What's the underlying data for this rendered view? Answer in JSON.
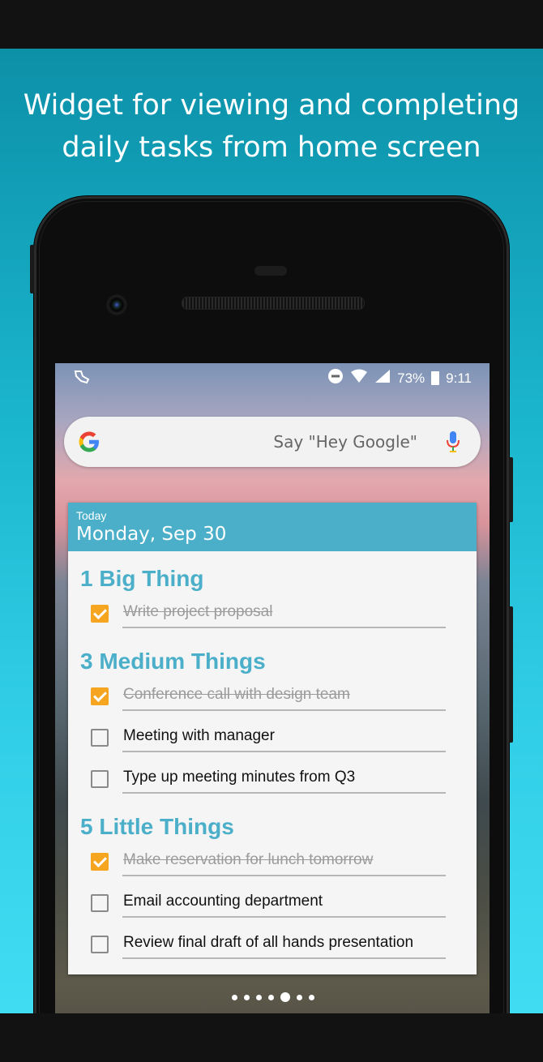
{
  "headline": {
    "line1": "Widget for viewing and completing",
    "line2": "daily tasks from home screen"
  },
  "statusbar": {
    "battery": "73%",
    "time": "9:11"
  },
  "search": {
    "hint": "Say \"Hey Google\""
  },
  "widget": {
    "header_small": "Today",
    "header_date": "Monday, Sep 30",
    "accent_color": "#4bafc9",
    "check_color": "#f5a51f",
    "sections": [
      {
        "title": "1 Big Thing",
        "tasks": [
          {
            "label": "Write project proposal",
            "done": true
          }
        ]
      },
      {
        "title": "3 Medium Things",
        "tasks": [
          {
            "label": "Conference call with design team",
            "done": true
          },
          {
            "label": "Meeting with manager",
            "done": false
          },
          {
            "label": "Type up meeting minutes from Q3",
            "done": false
          }
        ]
      },
      {
        "title": "5 Little Things",
        "tasks": [
          {
            "label": "Make reservation for lunch tomorrow",
            "done": true
          },
          {
            "label": "Email accounting department",
            "done": false
          },
          {
            "label": "Review final draft of all hands presentation",
            "done": false
          }
        ]
      }
    ]
  },
  "homescreen": {
    "active_page": 5,
    "page_count": 7
  },
  "dock": [
    "phone-icon",
    "messages-icon",
    "app-drawer-icon",
    "camera-icon",
    "photos-icon"
  ]
}
